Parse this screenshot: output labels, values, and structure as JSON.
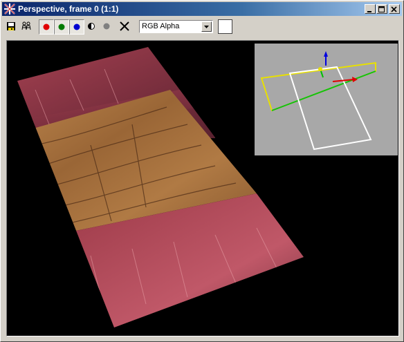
{
  "window": {
    "title": "Perspective, frame 0 (1:1)",
    "caption_buttons": [
      "minimize",
      "maximize",
      "close"
    ]
  },
  "toolbar": {
    "buttons": [
      {
        "name": "save-icon"
      },
      {
        "name": "clone-icon"
      },
      {
        "name": "red-channel-toggle",
        "color": "#e00000"
      },
      {
        "name": "green-channel-toggle",
        "color": "#008000"
      },
      {
        "name": "blue-channel-toggle",
        "color": "#0000d0"
      },
      {
        "name": "mono-icon"
      },
      {
        "name": "alpha-dot",
        "color": "#808080"
      },
      {
        "name": "clear-icon"
      }
    ],
    "channel_select": {
      "value": "RGB Alpha"
    },
    "color_swatch": "#ffffff"
  },
  "viewport": {
    "background": "#000000",
    "gizmo_inset_background": "#a8a8a8"
  }
}
